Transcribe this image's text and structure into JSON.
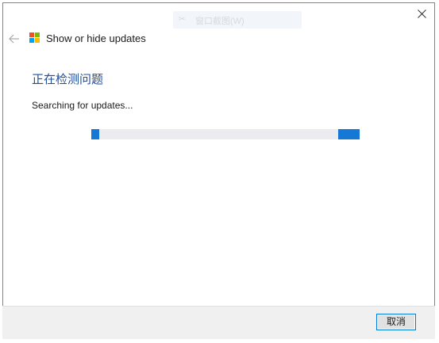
{
  "window": {
    "title": "Show or hide updates",
    "ghost_title": "窗口截图(W)"
  },
  "content": {
    "heading": "正在检测问题",
    "status": "Searching for updates..."
  },
  "progress": {
    "indeterminate": true,
    "segments": [
      {
        "start_fraction": 0.0,
        "end_fraction": 0.03
      },
      {
        "start_fraction": 0.92,
        "end_fraction": 1.0
      }
    ]
  },
  "footer": {
    "cancel_label": "取消"
  },
  "icons": {
    "back": "back-arrow-icon",
    "close": "close-icon",
    "app": "windows-logo-icon"
  },
  "colors": {
    "accent": "#1478d4",
    "heading": "#1f4e9c",
    "button_border": "#0078d7",
    "logo_red": "#f25022",
    "logo_green": "#7fba00",
    "logo_blue": "#00a4ef",
    "logo_yellow": "#ffb900"
  }
}
